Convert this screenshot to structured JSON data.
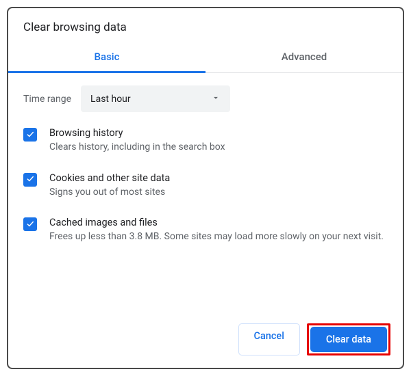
{
  "dialog": {
    "title": "Clear browsing data"
  },
  "tabs": {
    "basic": "Basic",
    "advanced": "Advanced"
  },
  "timeRange": {
    "label": "Time range",
    "value": "Last hour"
  },
  "options": [
    {
      "title": "Browsing history",
      "desc": "Clears history, including in the search box",
      "checked": true
    },
    {
      "title": "Cookies and other site data",
      "desc": "Signs you out of most sites",
      "checked": true
    },
    {
      "title": "Cached images and files",
      "desc": "Frees up less than 3.8 MB. Some sites may load more slowly on your next visit.",
      "checked": true
    }
  ],
  "buttons": {
    "cancel": "Cancel",
    "clear": "Clear data"
  },
  "colors": {
    "accent": "#1a73e8",
    "highlight": "#e60000"
  }
}
